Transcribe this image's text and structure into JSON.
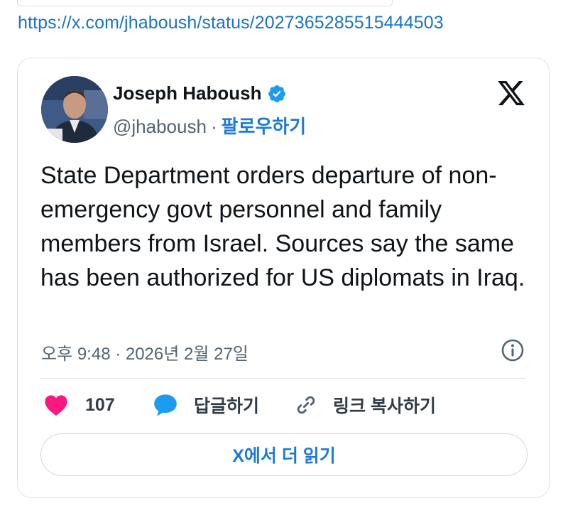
{
  "url": "https://x.com/jhaboush/status/2027365285515444503",
  "tweet": {
    "author_name": "Joseph Haboush",
    "handle": "@jhaboush",
    "separator": "·",
    "follow_label": "팔로우하기",
    "text": "State Department orders departure of non-emergency govt personnel and family members from Israel. Sources say the same has been authorized for US diplomats in Iraq.",
    "timestamp": "오후 9:48 · 2026년 2월 27일",
    "like_count": "107",
    "reply_label": "답글하기",
    "copy_link_label": "링크 복사하기",
    "read_more_label": "X에서 더 읽기"
  },
  "icons": {
    "verified": "verified-badge-icon",
    "x_logo": "x-logo-icon",
    "info": "info-icon",
    "like": "heart-icon",
    "reply": "speech-bubble-icon",
    "copy_link": "link-icon"
  },
  "colors": {
    "link": "#1a73c8",
    "accent": "#1d7bd8",
    "verified": "#1d9bf0",
    "heart": "#f91880",
    "muted": "#536471"
  }
}
